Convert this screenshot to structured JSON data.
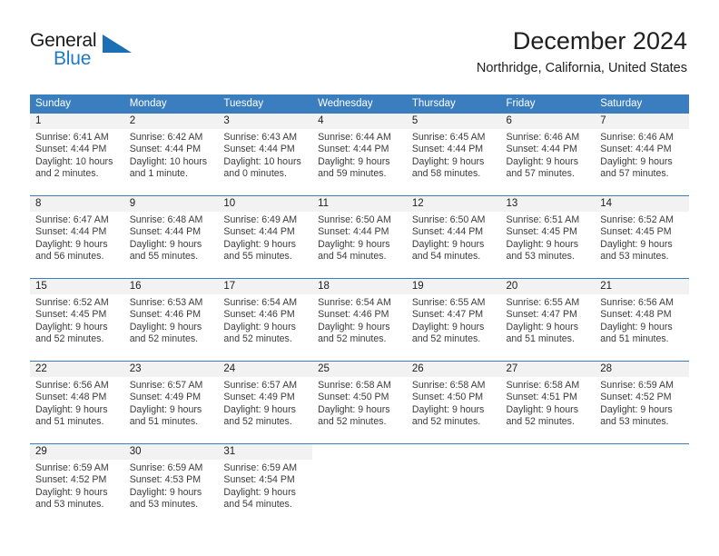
{
  "brand": {
    "name_part1": "General",
    "name_part2": "Blue",
    "accent_color": "#1a6fb5",
    "blue_text_color": "#1f7bc1"
  },
  "header": {
    "month_title": "December 2024",
    "location": "Northridge, California, United States"
  },
  "calendar": {
    "header_bg": "#3a7ebf",
    "daynum_bg": "#f2f2f2",
    "weekdays": [
      "Sunday",
      "Monday",
      "Tuesday",
      "Wednesday",
      "Thursday",
      "Friday",
      "Saturday"
    ],
    "weeks": [
      [
        {
          "day": "1",
          "sunrise": "Sunrise: 6:41 AM",
          "sunset": "Sunset: 4:44 PM",
          "daylight_line1": "Daylight: 10 hours",
          "daylight_line2": "and 2 minutes."
        },
        {
          "day": "2",
          "sunrise": "Sunrise: 6:42 AM",
          "sunset": "Sunset: 4:44 PM",
          "daylight_line1": "Daylight: 10 hours",
          "daylight_line2": "and 1 minute."
        },
        {
          "day": "3",
          "sunrise": "Sunrise: 6:43 AM",
          "sunset": "Sunset: 4:44 PM",
          "daylight_line1": "Daylight: 10 hours",
          "daylight_line2": "and 0 minutes."
        },
        {
          "day": "4",
          "sunrise": "Sunrise: 6:44 AM",
          "sunset": "Sunset: 4:44 PM",
          "daylight_line1": "Daylight: 9 hours",
          "daylight_line2": "and 59 minutes."
        },
        {
          "day": "5",
          "sunrise": "Sunrise: 6:45 AM",
          "sunset": "Sunset: 4:44 PM",
          "daylight_line1": "Daylight: 9 hours",
          "daylight_line2": "and 58 minutes."
        },
        {
          "day": "6",
          "sunrise": "Sunrise: 6:46 AM",
          "sunset": "Sunset: 4:44 PM",
          "daylight_line1": "Daylight: 9 hours",
          "daylight_line2": "and 57 minutes."
        },
        {
          "day": "7",
          "sunrise": "Sunrise: 6:46 AM",
          "sunset": "Sunset: 4:44 PM",
          "daylight_line1": "Daylight: 9 hours",
          "daylight_line2": "and 57 minutes."
        }
      ],
      [
        {
          "day": "8",
          "sunrise": "Sunrise: 6:47 AM",
          "sunset": "Sunset: 4:44 PM",
          "daylight_line1": "Daylight: 9 hours",
          "daylight_line2": "and 56 minutes."
        },
        {
          "day": "9",
          "sunrise": "Sunrise: 6:48 AM",
          "sunset": "Sunset: 4:44 PM",
          "daylight_line1": "Daylight: 9 hours",
          "daylight_line2": "and 55 minutes."
        },
        {
          "day": "10",
          "sunrise": "Sunrise: 6:49 AM",
          "sunset": "Sunset: 4:44 PM",
          "daylight_line1": "Daylight: 9 hours",
          "daylight_line2": "and 55 minutes."
        },
        {
          "day": "11",
          "sunrise": "Sunrise: 6:50 AM",
          "sunset": "Sunset: 4:44 PM",
          "daylight_line1": "Daylight: 9 hours",
          "daylight_line2": "and 54 minutes."
        },
        {
          "day": "12",
          "sunrise": "Sunrise: 6:50 AM",
          "sunset": "Sunset: 4:44 PM",
          "daylight_line1": "Daylight: 9 hours",
          "daylight_line2": "and 54 minutes."
        },
        {
          "day": "13",
          "sunrise": "Sunrise: 6:51 AM",
          "sunset": "Sunset: 4:45 PM",
          "daylight_line1": "Daylight: 9 hours",
          "daylight_line2": "and 53 minutes."
        },
        {
          "day": "14",
          "sunrise": "Sunrise: 6:52 AM",
          "sunset": "Sunset: 4:45 PM",
          "daylight_line1": "Daylight: 9 hours",
          "daylight_line2": "and 53 minutes."
        }
      ],
      [
        {
          "day": "15",
          "sunrise": "Sunrise: 6:52 AM",
          "sunset": "Sunset: 4:45 PM",
          "daylight_line1": "Daylight: 9 hours",
          "daylight_line2": "and 52 minutes."
        },
        {
          "day": "16",
          "sunrise": "Sunrise: 6:53 AM",
          "sunset": "Sunset: 4:46 PM",
          "daylight_line1": "Daylight: 9 hours",
          "daylight_line2": "and 52 minutes."
        },
        {
          "day": "17",
          "sunrise": "Sunrise: 6:54 AM",
          "sunset": "Sunset: 4:46 PM",
          "daylight_line1": "Daylight: 9 hours",
          "daylight_line2": "and 52 minutes."
        },
        {
          "day": "18",
          "sunrise": "Sunrise: 6:54 AM",
          "sunset": "Sunset: 4:46 PM",
          "daylight_line1": "Daylight: 9 hours",
          "daylight_line2": "and 52 minutes."
        },
        {
          "day": "19",
          "sunrise": "Sunrise: 6:55 AM",
          "sunset": "Sunset: 4:47 PM",
          "daylight_line1": "Daylight: 9 hours",
          "daylight_line2": "and 52 minutes."
        },
        {
          "day": "20",
          "sunrise": "Sunrise: 6:55 AM",
          "sunset": "Sunset: 4:47 PM",
          "daylight_line1": "Daylight: 9 hours",
          "daylight_line2": "and 51 minutes."
        },
        {
          "day": "21",
          "sunrise": "Sunrise: 6:56 AM",
          "sunset": "Sunset: 4:48 PM",
          "daylight_line1": "Daylight: 9 hours",
          "daylight_line2": "and 51 minutes."
        }
      ],
      [
        {
          "day": "22",
          "sunrise": "Sunrise: 6:56 AM",
          "sunset": "Sunset: 4:48 PM",
          "daylight_line1": "Daylight: 9 hours",
          "daylight_line2": "and 51 minutes."
        },
        {
          "day": "23",
          "sunrise": "Sunrise: 6:57 AM",
          "sunset": "Sunset: 4:49 PM",
          "daylight_line1": "Daylight: 9 hours",
          "daylight_line2": "and 51 minutes."
        },
        {
          "day": "24",
          "sunrise": "Sunrise: 6:57 AM",
          "sunset": "Sunset: 4:49 PM",
          "daylight_line1": "Daylight: 9 hours",
          "daylight_line2": "and 52 minutes."
        },
        {
          "day": "25",
          "sunrise": "Sunrise: 6:58 AM",
          "sunset": "Sunset: 4:50 PM",
          "daylight_line1": "Daylight: 9 hours",
          "daylight_line2": "and 52 minutes."
        },
        {
          "day": "26",
          "sunrise": "Sunrise: 6:58 AM",
          "sunset": "Sunset: 4:50 PM",
          "daylight_line1": "Daylight: 9 hours",
          "daylight_line2": "and 52 minutes."
        },
        {
          "day": "27",
          "sunrise": "Sunrise: 6:58 AM",
          "sunset": "Sunset: 4:51 PM",
          "daylight_line1": "Daylight: 9 hours",
          "daylight_line2": "and 52 minutes."
        },
        {
          "day": "28",
          "sunrise": "Sunrise: 6:59 AM",
          "sunset": "Sunset: 4:52 PM",
          "daylight_line1": "Daylight: 9 hours",
          "daylight_line2": "and 53 minutes."
        }
      ],
      [
        {
          "day": "29",
          "sunrise": "Sunrise: 6:59 AM",
          "sunset": "Sunset: 4:52 PM",
          "daylight_line1": "Daylight: 9 hours",
          "daylight_line2": "and 53 minutes."
        },
        {
          "day": "30",
          "sunrise": "Sunrise: 6:59 AM",
          "sunset": "Sunset: 4:53 PM",
          "daylight_line1": "Daylight: 9 hours",
          "daylight_line2": "and 53 minutes."
        },
        {
          "day": "31",
          "sunrise": "Sunrise: 6:59 AM",
          "sunset": "Sunset: 4:54 PM",
          "daylight_line1": "Daylight: 9 hours",
          "daylight_line2": "and 54 minutes."
        },
        {
          "day": "",
          "sunrise": "",
          "sunset": "",
          "daylight_line1": "",
          "daylight_line2": ""
        },
        {
          "day": "",
          "sunrise": "",
          "sunset": "",
          "daylight_line1": "",
          "daylight_line2": ""
        },
        {
          "day": "",
          "sunrise": "",
          "sunset": "",
          "daylight_line1": "",
          "daylight_line2": ""
        },
        {
          "day": "",
          "sunrise": "",
          "sunset": "",
          "daylight_line1": "",
          "daylight_line2": ""
        }
      ]
    ]
  }
}
